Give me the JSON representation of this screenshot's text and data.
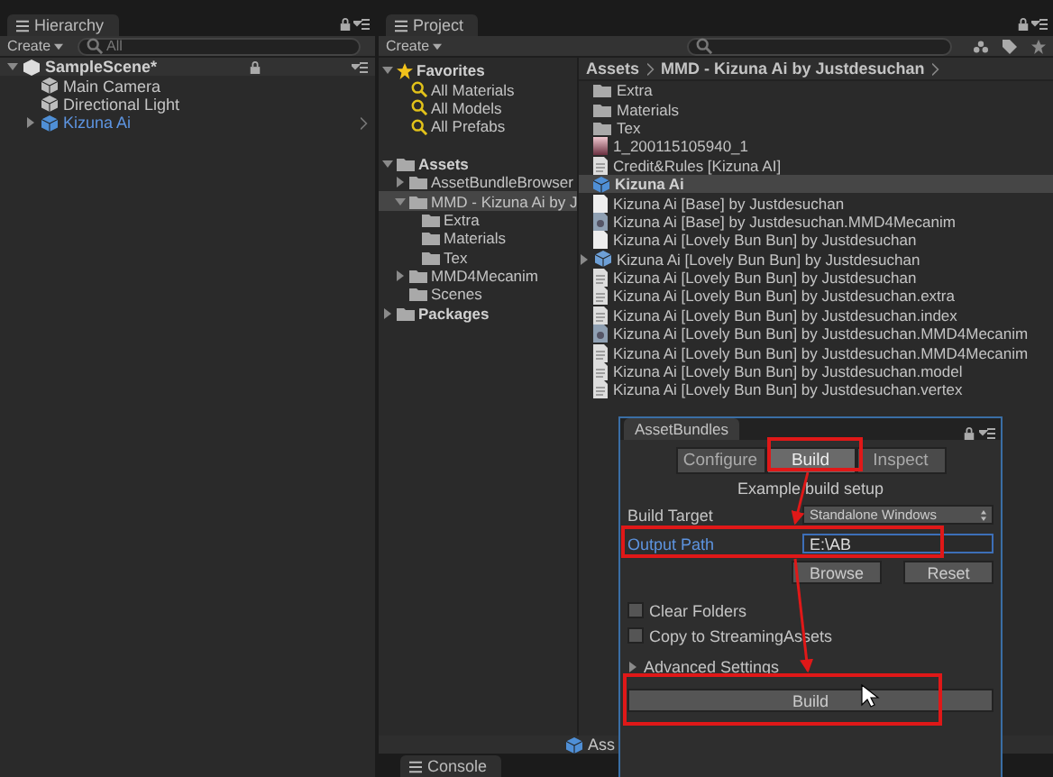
{
  "hierarchy": {
    "title": "Hierarchy",
    "create": "Create",
    "placeholder": "All",
    "scene": {
      "name": "SampleScene*",
      "expanded": true
    },
    "items": [
      {
        "name": "Main Camera",
        "kind": "object",
        "collapsed": false
      },
      {
        "name": "Directional Light",
        "kind": "object",
        "collapsed": false
      },
      {
        "name": "Kizuna Ai",
        "kind": "prefab",
        "collapsed": true
      }
    ]
  },
  "project": {
    "title": "Project",
    "create": "Create",
    "favorites": {
      "label": "Favorites",
      "expanded": true,
      "items": [
        "All Materials",
        "All Models",
        "All Prefabs"
      ]
    },
    "tree": [
      {
        "label": "Assets",
        "expanded": true,
        "selected": false,
        "children": [
          {
            "label": "AssetBundleBrowser",
            "expanded": false,
            "selected": false
          },
          {
            "label": "MMD - Kizuna Ai by J",
            "expanded": true,
            "selected": true,
            "children": [
              {
                "label": "Extra",
                "selected": false
              },
              {
                "label": "Materials",
                "selected": false
              },
              {
                "label": "Tex",
                "selected": false
              }
            ]
          },
          {
            "label": "MMD4Mecanim",
            "expanded": false,
            "selected": false
          },
          {
            "label": "Scenes",
            "selected": false
          }
        ]
      },
      {
        "label": "Packages",
        "expanded": false,
        "selected": false
      }
    ],
    "breadcrumb": [
      "Assets",
      "MMD - Kizuna Ai by Justdesuchan"
    ],
    "files": [
      {
        "name": "Extra",
        "kind": "folder",
        "selected": false
      },
      {
        "name": "Materials",
        "kind": "folder",
        "selected": false
      },
      {
        "name": "Tex",
        "kind": "folder",
        "selected": false
      },
      {
        "name": "1_200115105940_1",
        "kind": "image",
        "selected": false
      },
      {
        "name": "Credit&Rules [Kizuna AI]",
        "kind": "text",
        "selected": false
      },
      {
        "name": "Kizuna Ai",
        "kind": "prefab",
        "selected": true
      },
      {
        "name": "Kizuna Ai [Base] by Justdesuchan",
        "kind": "file",
        "selected": false
      },
      {
        "name": "Kizuna Ai [Base] by Justdesuchan.MMD4Mecanim",
        "kind": "asset",
        "selected": false
      },
      {
        "name": "Kizuna Ai [Lovely Bun Bun] by Justdesuchan",
        "kind": "file",
        "selected": false
      },
      {
        "name": "Kizuna Ai [Lovely Bun Bun] by Justdesuchan",
        "kind": "model",
        "selected": false
      },
      {
        "name": "Kizuna Ai [Lovely Bun Bun] by Justdesuchan",
        "kind": "text",
        "selected": false
      },
      {
        "name": "Kizuna Ai [Lovely Bun Bun] by Justdesuchan.extra",
        "kind": "text",
        "selected": false
      },
      {
        "name": "Kizuna Ai [Lovely Bun Bun] by Justdesuchan.index",
        "kind": "text",
        "selected": false
      },
      {
        "name": "Kizuna Ai [Lovely Bun Bun] by Justdesuchan.MMD4Mecanim",
        "kind": "asset",
        "selected": false
      },
      {
        "name": "Kizuna Ai [Lovely Bun Bun] by Justdesuchan.MMD4Mecanim",
        "kind": "text",
        "selected": false
      },
      {
        "name": "Kizuna Ai [Lovely Bun Bun] by Justdesuchan.model",
        "kind": "text",
        "selected": false
      },
      {
        "name": "Kizuna Ai [Lovely Bun Bun] by Justdesuchan.vertex",
        "kind": "text",
        "selected": false
      }
    ],
    "footer": "Ass"
  },
  "console": {
    "title": "Console"
  },
  "asset_bundles": {
    "title": "AssetBundles",
    "tabs": [
      {
        "label": "Configure",
        "selected": false
      },
      {
        "label": "Build",
        "selected": true
      },
      {
        "label": "Inspect",
        "selected": false
      }
    ],
    "subtitle": "Example build setup",
    "build_target": {
      "label": "Build Target",
      "value": "Standalone Windows"
    },
    "output_path": {
      "label": "Output Path",
      "value": "E:\\AB"
    },
    "buttons": [
      "Browse",
      "Reset"
    ],
    "checkboxes": [
      {
        "label": "Clear Folders",
        "checked": false
      },
      {
        "label": "Copy to StreamingAssets",
        "checked": false
      }
    ],
    "advanced": {
      "label": "Advanced Settings",
      "expanded": false
    },
    "build_button": "Build"
  }
}
